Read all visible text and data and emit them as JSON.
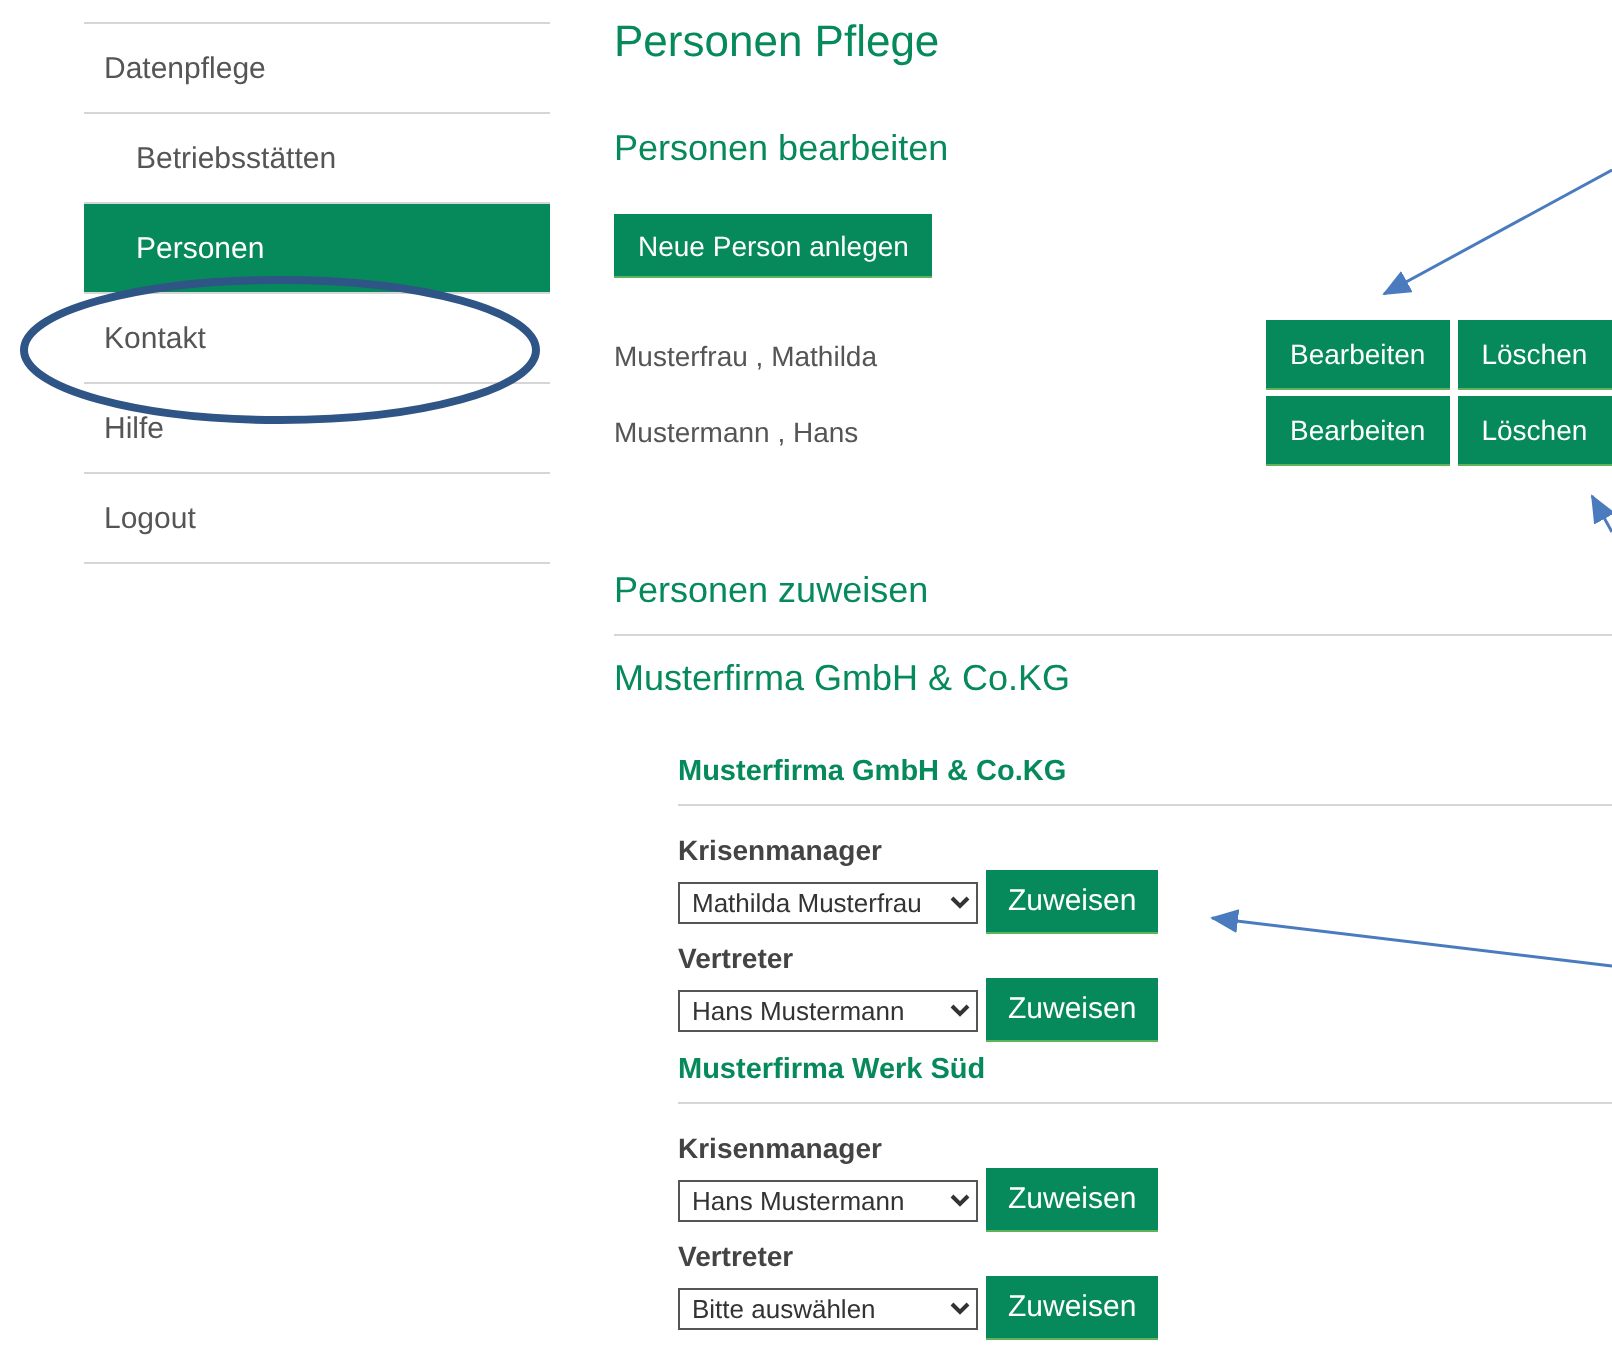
{
  "sidebar": {
    "items": [
      {
        "label": "Datenpflege",
        "selected": false,
        "children": [
          {
            "label": "Betriebsstätten",
            "selected": false
          },
          {
            "label": "Personen",
            "selected": true
          }
        ]
      },
      {
        "label": "Kontakt",
        "selected": false
      },
      {
        "label": "Hilfe",
        "selected": false
      },
      {
        "label": "Logout",
        "selected": false
      }
    ]
  },
  "page_title": "Personen Pflege",
  "edit_section": {
    "heading": "Personen bearbeiten",
    "new_button": "Neue Person anlegen",
    "persons": [
      {
        "name": "Musterfrau , Mathilda",
        "edit": "Bearbeiten",
        "delete": "Löschen"
      },
      {
        "name": "Mustermann , Hans",
        "edit": "Bearbeiten",
        "delete": "Löschen"
      }
    ]
  },
  "assign_section": {
    "heading": "Personen zuweisen",
    "company": "Musterfirma GmbH & Co.KG",
    "sites": [
      {
        "name": "Musterfirma GmbH & Co.KG",
        "roles": [
          {
            "label": "Krisenmanager",
            "value": "Mathilda Musterfrau",
            "button": "Zuweisen"
          },
          {
            "label": "Vertreter",
            "value": "Hans Mustermann",
            "button": "Zuweisen"
          }
        ]
      },
      {
        "name": "Musterfirma Werk Süd",
        "roles": [
          {
            "label": "Krisenmanager",
            "value": "Hans Mustermann",
            "button": "Zuweisen"
          },
          {
            "label": "Vertreter",
            "value": "Bitte auswählen",
            "button": "Zuweisen"
          }
        ]
      }
    ]
  }
}
